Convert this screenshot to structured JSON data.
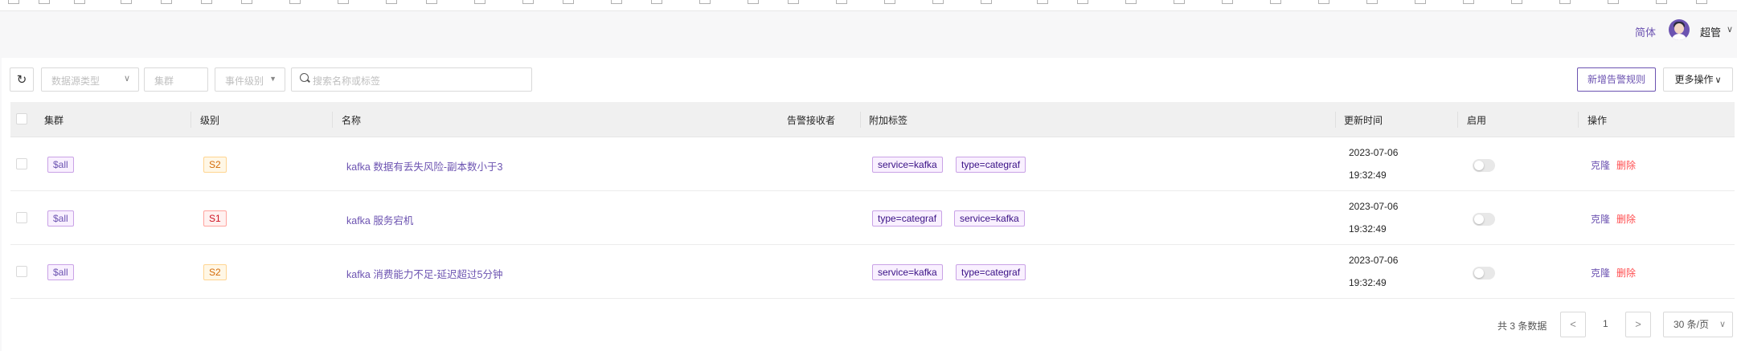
{
  "header": {
    "language": "简体",
    "username": "超管",
    "user_caret": "∨"
  },
  "toolbar": {
    "refresh_icon": "↻",
    "datasource_type_placeholder": "数据源类型",
    "cluster_placeholder": "集群",
    "event_level_placeholder": "事件级别",
    "search_placeholder": "搜索名称或标签",
    "add_rule_label": "新增告警规则",
    "more_actions_label": "更多操作",
    "caret": "∨",
    "filled_caret": "▼"
  },
  "table": {
    "columns": {
      "cluster": "集群",
      "level": "级别",
      "name": "名称",
      "receivers": "告警接收者",
      "tags": "附加标签",
      "updated": "更新时间",
      "enabled": "启用",
      "actions": "操作"
    },
    "rows": [
      {
        "cluster": "$all",
        "level": "S2",
        "name": "kafka 数据有丢失风险-副本数小于3",
        "tags": [
          "service=kafka",
          "type=categraf"
        ],
        "updated_date": "2023-07-06",
        "updated_time": "19:32:49",
        "enabled": false,
        "clone": "克隆",
        "delete": "删除"
      },
      {
        "cluster": "$all",
        "level": "S1",
        "name": "kafka 服务宕机",
        "tags": [
          "type=categraf",
          "service=kafka"
        ],
        "updated_date": "2023-07-06",
        "updated_time": "19:32:49",
        "enabled": false,
        "clone": "克隆",
        "delete": "删除"
      },
      {
        "cluster": "$all",
        "level": "S2",
        "name": "kafka 消费能力不足-延迟超过5分钟",
        "tags": [
          "service=kafka",
          "type=categraf"
        ],
        "updated_date": "2023-07-06",
        "updated_time": "19:32:49",
        "enabled": false,
        "clone": "克隆",
        "delete": "删除"
      }
    ]
  },
  "pagination": {
    "total_text": "共 3 条数据",
    "prev": "<",
    "current_page": "1",
    "next": ">",
    "page_size": "30 条/页"
  },
  "colors": {
    "brand": "#6c53b1",
    "danger": "#ff4d4f"
  }
}
